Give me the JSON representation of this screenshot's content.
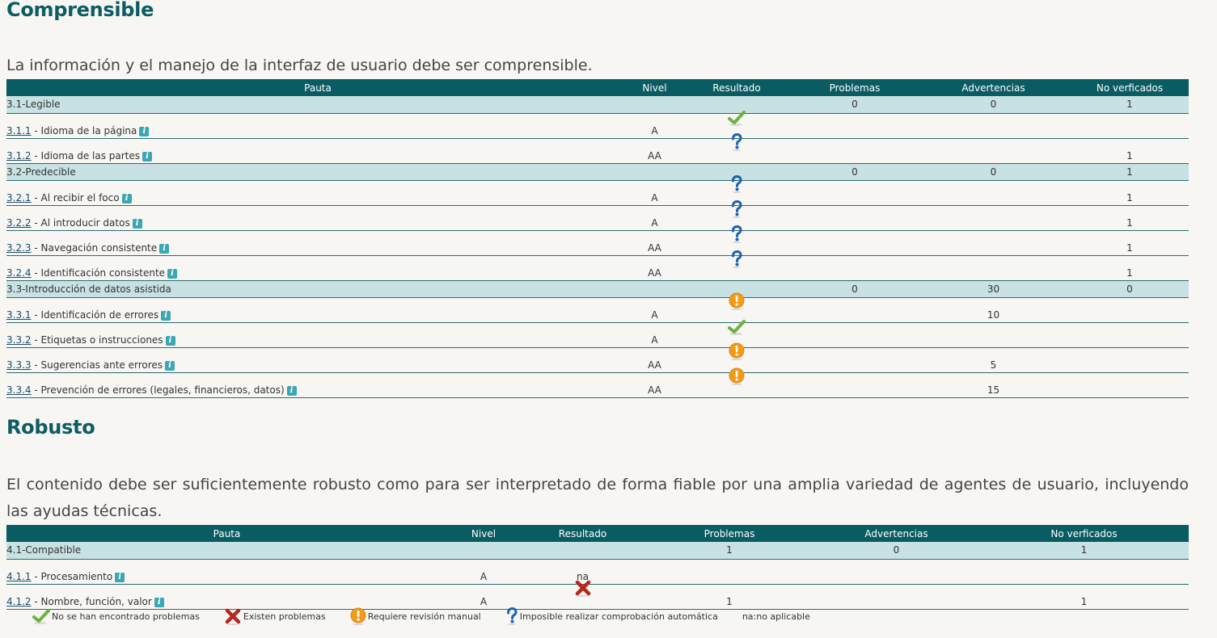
{
  "section1": {
    "title": "Comprensible",
    "description": "La información y el manejo de la interfaz de usuario debe ser comprensible."
  },
  "section2": {
    "title": "Robusto",
    "description": "El contenido debe ser suficientemente robusto como para ser interpretado de forma fiable por una amplia variedad de agentes de usuario, incluyendo las ayudas técnicas."
  },
  "table_headers": {
    "pauta": "Pauta",
    "nivel": "Nivel",
    "resultado": "Resultado",
    "problemas": "Problemas",
    "advertencias": "Advertencias",
    "no_verificados": "No verficados"
  },
  "table1": {
    "g31": {
      "label": "3.1-Legible",
      "problemas": "0",
      "advertencias": "0",
      "no_verificados": "1"
    },
    "r311": {
      "code": "3.1.1",
      "name": " - Idioma de la página",
      "nivel": "A",
      "result_icon": "check-icon",
      "problemas": "",
      "advertencias": "",
      "no_verificados": ""
    },
    "r312": {
      "code": "3.1.2",
      "name": " - Idioma de las partes",
      "nivel": "AA",
      "result_icon": "question-icon",
      "problemas": "",
      "advertencias": "",
      "no_verificados": "1"
    },
    "g32": {
      "label": "3.2-Predecible",
      "problemas": "0",
      "advertencias": "0",
      "no_verificados": "1"
    },
    "r321": {
      "code": "3.2.1",
      "name": " - Al recibir el foco",
      "nivel": "A",
      "result_icon": "question-icon",
      "no_verificados": "1"
    },
    "r322": {
      "code": "3.2.2",
      "name": " - Al introducir datos",
      "nivel": "A",
      "result_icon": "question-icon",
      "no_verificados": "1"
    },
    "r323": {
      "code": "3.2.3",
      "name": " - Navegación consistente",
      "nivel": "AA",
      "result_icon": "question-icon",
      "no_verificados": "1"
    },
    "r324": {
      "code": "3.2.4",
      "name": " - Identificación consistente",
      "nivel": "AA",
      "result_icon": "question-icon",
      "no_verificados": "1"
    },
    "g33": {
      "label": "3.3-Introducción de datos asistida",
      "problemas": "0",
      "advertencias": "30",
      "no_verificados": "0"
    },
    "r331": {
      "code": "3.3.1",
      "name": " - Identificación de errores",
      "nivel": "A",
      "result_icon": "warning-icon",
      "advertencias": "10"
    },
    "r332": {
      "code": "3.3.2",
      "name": " - Etiquetas o instrucciones",
      "nivel": "A",
      "result_icon": "check-icon"
    },
    "r333": {
      "code": "3.3.3",
      "name": " - Sugerencias ante errores",
      "nivel": "AA",
      "result_icon": "warning-icon",
      "advertencias": "5"
    },
    "r334": {
      "code": "3.3.4",
      "name": " - Prevención de errores (legales, financieros, datos)",
      "nivel": "AA",
      "result_icon": "warning-icon",
      "advertencias": "15"
    }
  },
  "table2": {
    "g41": {
      "label": "4.1-Compatible",
      "problemas": "1",
      "advertencias": "0",
      "no_verificados": "1"
    },
    "r411": {
      "code": "4.1.1",
      "name": " - Procesamiento",
      "nivel": "A",
      "resultado_text": "na"
    },
    "r412": {
      "code": "4.1.2",
      "name": " - Nombre, función, valor",
      "nivel": "A",
      "result_icon": "cross-icon",
      "problemas": "1",
      "no_verificados": "1"
    }
  },
  "info_icon_glyph": "i",
  "legend": {
    "check": "No se han encontrado problemas",
    "cross": "Existen problemas",
    "warning": "Requiere revisión manual",
    "question": "Imposible realizar comprobación automática",
    "na": "na:no aplicable"
  },
  "colors": {
    "header_bg": "#0a5c63",
    "group_bg": "#c8e1e3",
    "title": "#0c5d63",
    "check": "#6cb33f",
    "cross": "#b5261e",
    "warning": "#f39c12",
    "question": "#1a63b0"
  }
}
